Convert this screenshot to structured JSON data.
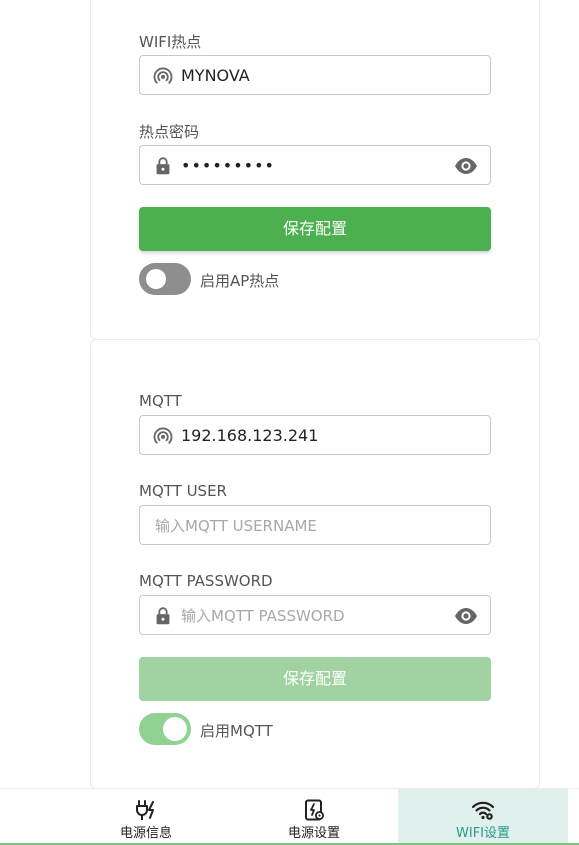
{
  "hotspot_card": {
    "ssid_label": "WIFI热点",
    "ssid_value": "MYNOVA",
    "password_label": "热点密码",
    "password_value": "•••••••••",
    "save_label": "保存配置",
    "toggle_label": "启用AP热点",
    "toggle_on": false
  },
  "mqtt_card": {
    "server_label": "MQTT",
    "server_value": "192.168.123.241",
    "user_label": "MQTT USER",
    "user_placeholder": "输入MQTT USERNAME",
    "password_label": "MQTT PASSWORD",
    "password_placeholder": "输入MQTT PASSWORD",
    "save_label": "保存配置",
    "toggle_label": "启用MQTT",
    "toggle_on": true
  },
  "bottom_nav": {
    "items": [
      {
        "label": "电源信息",
        "icon": "power-plug-icon"
      },
      {
        "label": "电源设置",
        "icon": "power-settings-icon"
      },
      {
        "label": "WIFI设置",
        "icon": "wifi-settings-icon",
        "selected": true
      }
    ]
  },
  "colors": {
    "primary_green": "#4caf50",
    "disabled_green": "#a1d3a2",
    "toggle_on": "#8fd291",
    "toggle_off": "#8e8e8e",
    "nav_selected_bg": "#e0f0ec",
    "nav_selected_text": "#2a9a8a"
  }
}
